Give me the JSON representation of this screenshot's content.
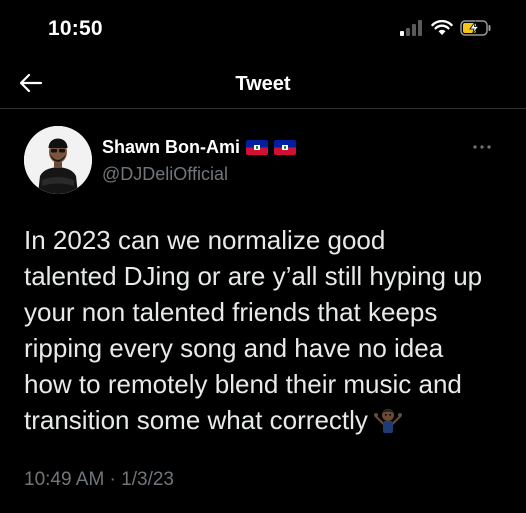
{
  "status_bar": {
    "time": "10:50",
    "icons": [
      "signal-icon",
      "wifi-icon",
      "battery-charging-icon"
    ]
  },
  "nav": {
    "title": "Tweet",
    "back_icon": "back-arrow-icon"
  },
  "tweet": {
    "author": {
      "display_name": "Shawn Bon-Ami",
      "handle": "@DJDeliOfficial",
      "flags": [
        "haiti-flag-icon",
        "haiti-flag-icon"
      ]
    },
    "more_icon": "more-dots-icon",
    "text": "In 2023 can we normalize good\ntalented DJing or are y’all still hyping up\nyour non talented friends that keeps\nripping every song and have no idea\nhow to remotely blend their music and\ntransition some what correctly",
    "emoji": "person-shrugging-emoji",
    "timestamp": "10:49 AM · 1/3/23"
  },
  "colors": {
    "background": "#000000",
    "text_primary": "#e7e9ea",
    "text_secondary": "#71767b",
    "divider": "#2f3336",
    "flag_blue": "#00209f",
    "flag_red": "#d21034"
  }
}
